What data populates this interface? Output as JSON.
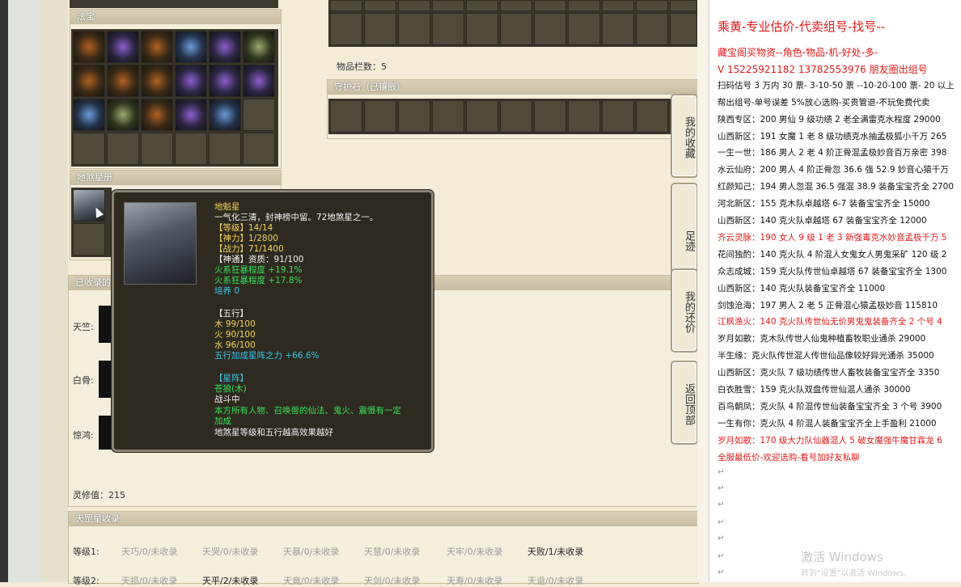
{
  "sections": {
    "fabao_title": "法宝",
    "disha_title": "地煞星册",
    "collected_title": "已收录的",
    "guard_title": "守护石（已镶嵌）",
    "tiangang_title": "天罡星收录"
  },
  "inventory": {
    "count_text": "物品栏数：5"
  },
  "collected": {
    "rows": [
      "天竺:",
      "白骨:",
      "惊鸿:"
    ],
    "spirit_value": "灵修值：215"
  },
  "tooltip": {
    "name": "地魁星",
    "desc": "一气化三清，封神榜中留。72地煞星之一。",
    "level": "【等级】14/14",
    "divine": "【神力】1/2800",
    "combat": "【战力】71/1400",
    "tong": "【神通】资质：91/100",
    "fire1": "火系狂暴程度 +19.1%",
    "fire2": "火系狂暴程度 +17.8%",
    "nurture": "培养 0",
    "wuxing_title": "【五行】",
    "wood": "木 99/100",
    "fire": "火 90/100",
    "water": "水 96/100",
    "wuxing_bonus": "五行加成星阵之力 +66.6%",
    "array_title": "【星阵】",
    "array_name": "苍狼(木)",
    "state": "战斗中",
    "effect1": "本方所有人物、召唤兽的仙法、鬼火、震慑有一定",
    "effect2": "加成",
    "note": "地煞星等级和五行越高效果越好"
  },
  "side_buttons": {
    "collect": "我的收藏",
    "footprint": "足迹",
    "counter": "我的还价",
    "top": "返回顶部"
  },
  "tiangang": {
    "level1_label": "等级1:",
    "level2_label": "等级2:",
    "level1": [
      "天巧/0/未收录",
      "天哭/0/未收录",
      "天暴/0/未收录",
      "天慧/0/未收录",
      "天牢/0/未收录",
      "天败/1/未收录"
    ],
    "level2": [
      "天损/0/未收录",
      "天平/2/未收录",
      "天竟/0/未收录",
      "天剑/0/未收录",
      "天寿/0/未收录",
      "天退/0/未收录"
    ]
  },
  "chat": {
    "title": "乘黄-专业估价-代卖组号-找号--",
    "lines": [
      {
        "t": "藏宝阁买物资--角色-物品-机-好处-多-",
        "c": "red"
      },
      {
        "t": "V 15225921182    13782553976 朋友圈出组号",
        "c": "red"
      },
      {
        "t": "扫码估号 3 万内 30 票- 3-10-50 票  --10-20-100 票- 20 以上",
        "c": ""
      },
      {
        "t": "帮出组号-单号误差 5%放心选购-买贵管退-不玩免费代卖",
        "c": ""
      },
      {
        "t": "陕西专区：200 男仙 9 级功绩 2 老全满雷克水程度 29000",
        "c": ""
      },
      {
        "t": "山西新区：191 女魔 1 老 8 级功绩克水抽孟极狐小千万 265",
        "c": ""
      },
      {
        "t": "一生一世：186 男人 2 老 4 阶正骨混孟极妙音百万亲密 398",
        "c": ""
      },
      {
        "t": "水云仙府：200 男人 4 阶正骨忽 36.6 强 52.9 妙音心猿千万",
        "c": ""
      },
      {
        "t": "红颜知己：194 男人忽混 36.5 强混 38.9 装备宝宝齐全 2700",
        "c": ""
      },
      {
        "t": "河北新区：155 克木队卓越塔 6-7 装备宝宝齐全 15000",
        "c": ""
      },
      {
        "t": "山西新区：140 克火队卓越塔 67 装备宝宝齐全 12000",
        "c": ""
      },
      {
        "t": "齐云灵脉：190 女人 9 级 1 老 3 新强毒克水妙音孟极千万 5",
        "c": "red"
      },
      {
        "t": "花间独酌：140 克火队 4 阶混人女鬼女人男鬼采矿 120 级 2",
        "c": ""
      },
      {
        "t": "众志成城：159 克火队传世仙卓越塔 67 装备宝宝齐全 1300",
        "c": ""
      },
      {
        "t": "山西新区：140 克火队装备宝宝齐全 11000",
        "c": ""
      },
      {
        "t": "剑蚀沧海：197 男人 2 老 5 正骨混心猿孟极妙音 115810",
        "c": ""
      },
      {
        "t": "江枫渔火：140 克火队传世仙无价男鬼鬼装备齐全 2 个号 4",
        "c": "red"
      },
      {
        "t": "岁月如歌：克木队传世人仙鬼种植畜牧职业通杀 29000",
        "c": ""
      },
      {
        "t": "半生缘：克火队传世混人传世仙品像较好异光通杀 35000",
        "c": ""
      },
      {
        "t": "山西新区：克火队 7 级功绩传世人畜牧装备宝宝齐全 3350",
        "c": ""
      },
      {
        "t": "白衣胜雪：159 克火队双盘传世仙混人通杀 30000",
        "c": ""
      },
      {
        "t": "百鸟朝凤：克火队 4 阶混传世仙装备宝宝齐全 3 个号 3900",
        "c": ""
      },
      {
        "t": "一生有你：克火队 4 阶混人装备宝宝齐全上手盈利 21000",
        "c": ""
      },
      {
        "t": "岁月如歌：170 级大力队仙器混人 5 破女魔强牛魔甘霖龙 6",
        "c": "red"
      },
      {
        "t": "全服最低价-欢迎选购-看号加好友私聊",
        "c": "red"
      }
    ],
    "watermark": "激活 Windows",
    "watermark_sub": "转到\"设置\"以激活 Windows。"
  }
}
